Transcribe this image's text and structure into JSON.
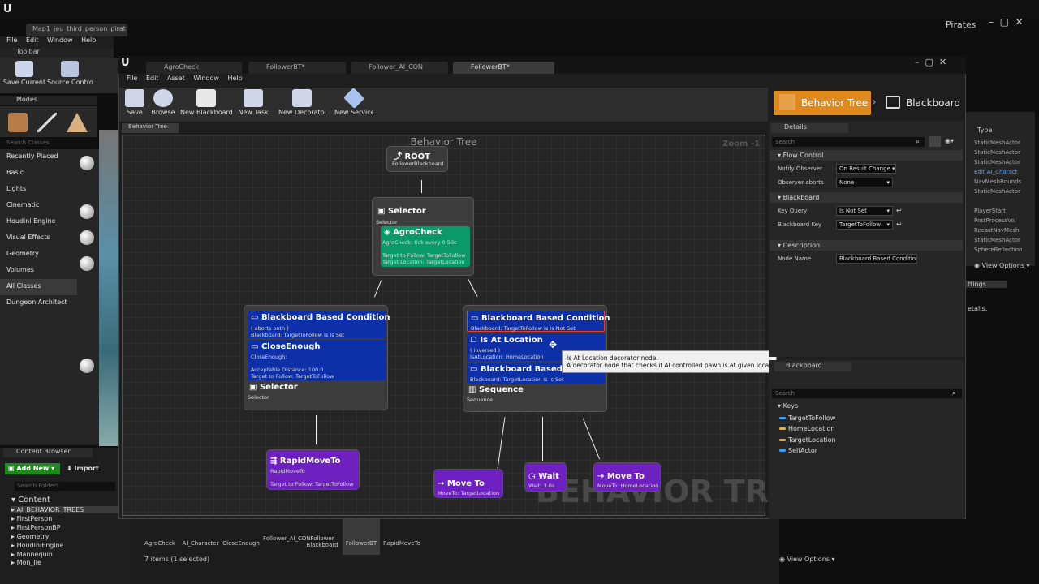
{
  "outer": {
    "tab": "Map1_jeu_third_person_pirat",
    "menu": [
      "File",
      "Edit",
      "Window",
      "Help"
    ],
    "project": "Pirates",
    "toolbar_tab": "Toolbar",
    "toolbar_buttons": [
      "Save Current",
      "Source Control"
    ],
    "modes_tab": "Modes",
    "search_classes": "Search Classes",
    "categories": [
      "Recently Placed",
      "Basic",
      "Lights",
      "Cinematic",
      "Houdini Engine",
      "Visual Effects",
      "Geometry",
      "Volumes",
      "All Classes",
      "Dungeon Architect"
    ],
    "selected_category": "All Classes"
  },
  "content_browser": {
    "tab": "Content Browser",
    "add_new": "Add New",
    "import": "Import",
    "search_folders": "Search Folders",
    "root": "Content",
    "folders": [
      "AI_BEHAVIOR_TREES",
      "FirstPerson",
      "FirstPersonBP",
      "Geometry",
      "HoudiniEngine",
      "Mannequin",
      "Mon_Ile"
    ],
    "assets": [
      "AgroCheck",
      "AI_Character",
      "CloseEnough",
      "Follower_AI_CON",
      "Follower Blackboard",
      "FollowerBT",
      "RapidMoveTo"
    ],
    "count": "7 items (1 selected)",
    "view_options": "View Options"
  },
  "bt": {
    "tabs": [
      "AgroCheck",
      "FollowerBT*",
      "Follower_AI_CON",
      "FollowerBT*"
    ],
    "menu": [
      "File",
      "Edit",
      "Asset",
      "Window",
      "Help"
    ],
    "toolbar": [
      "Save",
      "Browse",
      "New Blackboard",
      "New Task",
      "New Decorator",
      "New Service"
    ],
    "mode_bt": "Behavior Tree",
    "mode_bb": "Blackboard",
    "graph_tab": "Behavior Tree",
    "graph_title": "Behavior Tree",
    "zoom": "Zoom -1",
    "watermark": "BEHAVIOR TREE"
  },
  "nodes": {
    "root": {
      "title": "ROOT",
      "sub": "FollowerBlackboard"
    },
    "sel1": {
      "title": "Selector",
      "sub": "Selector"
    },
    "agro": {
      "title": "AgroCheck",
      "sub": "AgroCheck: tick every 0.50s",
      "l1": "Target to Follow: TargetToFollow",
      "l2": "Target Location: TargetLocation"
    },
    "bbc1": {
      "title": "Blackboard Based Condition",
      "sub1": "( aborts both )",
      "sub2": "Blackboard: TargetToFollow is Is Set"
    },
    "close": {
      "title": "CloseEnough",
      "sub": "CloseEnough:",
      "l1": "Acceptable Distance: 100.0",
      "l2": "Target to Follow: TargetToFollow"
    },
    "sel2": {
      "title": "Selector",
      "sub": "Selector"
    },
    "bbc2": {
      "title": "Blackboard Based Condition",
      "sub": "Blackboard: TargetToFollow is Is Not Set"
    },
    "atloc": {
      "title": "Is At Location",
      "sub1": "( inversed )",
      "sub2": "IsAtLocation: HomeLocation"
    },
    "bbc3": {
      "title": "Blackboard Based C",
      "sub": "Blackboard: TargetLocation is Is Set"
    },
    "seq": {
      "title": "Sequence",
      "sub": "Sequence"
    },
    "rapid": {
      "title": "RapidMoveTo",
      "sub": "RapidMoveTo",
      "l1": "Target to Follow: TargetToFollow"
    },
    "move1": {
      "title": "Move To",
      "sub": "MoveTo: TargetLocation"
    },
    "wait": {
      "title": "Wait",
      "sub": "Wait: 3.0s"
    },
    "move2": {
      "title": "Move To",
      "sub": "MoveTo: HomeLocation"
    }
  },
  "tooltip": {
    "line1": "Is At Location decorator node.",
    "line2": "A decorator node that checks if AI controlled pawn is at given location."
  },
  "details": {
    "tab": "Details",
    "search": "Search",
    "flow_control": "Flow Control",
    "notify_observer_label": "Notify Observer",
    "notify_observer_value": "On Result Change",
    "observer_aborts_label": "Observer aborts",
    "observer_aborts_value": "None",
    "blackboard_sec": "Blackboard",
    "key_query_label": "Key Query",
    "key_query_value": "Is Not Set",
    "bb_key_label": "Blackboard Key",
    "bb_key_value": "TargetToFollow",
    "description_sec": "Description",
    "node_name_label": "Node Name",
    "node_name_value": "Blackboard Based Condition"
  },
  "blackboard": {
    "tab": "Blackboard",
    "search": "Search",
    "keys_header": "Keys",
    "keys": [
      {
        "name": "TargetToFollow",
        "color": "#3aa0ff"
      },
      {
        "name": "HomeLocation",
        "color": "#f0b030"
      },
      {
        "name": "TargetLocation",
        "color": "#f0b030"
      },
      {
        "name": "SelfActor",
        "color": "#3aa0ff"
      }
    ]
  },
  "outliner": {
    "type_header": "Type",
    "rows": [
      "StaticMeshActor",
      "StaticMeshActor",
      "StaticMeshActor",
      "Edit AI_Charact",
      "NavMeshBounds",
      "StaticMeshActor",
      "PlayerStart",
      "PostProcessVol",
      "RecastNavMesh",
      "StaticMeshActor",
      "SphereReflection"
    ],
    "view_options": "View Options",
    "settings": "ttings",
    "details": "etails."
  }
}
